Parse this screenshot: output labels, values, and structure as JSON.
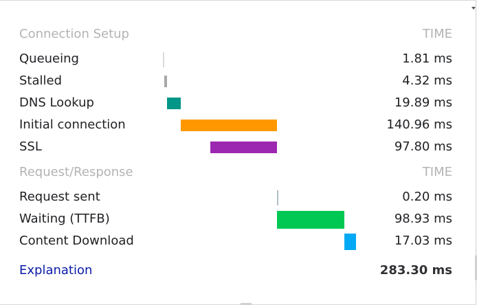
{
  "connection_setup": {
    "header": "Connection Setup",
    "time_header": "TIME",
    "rows": [
      {
        "label": "Queueing",
        "value": "1.81 ms",
        "color": "#dadce0"
      },
      {
        "label": "Stalled",
        "value": "4.32 ms",
        "color": "#a8a8a8"
      },
      {
        "label": "DNS Lookup",
        "value": "19.89 ms",
        "color": "#009688"
      },
      {
        "label": "Initial connection",
        "value": "140.96 ms",
        "color": "#ff9800"
      },
      {
        "label": "SSL",
        "value": "97.80 ms",
        "color": "#9c27b0"
      }
    ]
  },
  "request_response": {
    "header": "Request/Response",
    "time_header": "TIME",
    "rows": [
      {
        "label": "Request sent",
        "value": "0.20 ms",
        "color": "#b0bec5"
      },
      {
        "label": "Waiting (TTFB)",
        "value": "98.93 ms",
        "color": "#00c853"
      },
      {
        "label": "Content Download",
        "value": "17.03 ms",
        "color": "#03a9f4"
      }
    ]
  },
  "footer": {
    "explanation": "Explanation",
    "total": "283.30 ms"
  }
}
